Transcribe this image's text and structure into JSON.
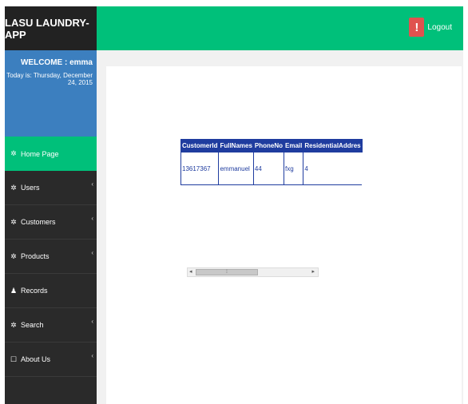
{
  "app": {
    "title": "LASU LAUNDRY-APP"
  },
  "header": {
    "logout_label": "Logout",
    "logout_icon": "alert-icon"
  },
  "welcome": {
    "greeting": "WELCOME : emma",
    "date": "Today is: Thursday, December 24, 2015"
  },
  "sidebar": {
    "items": [
      {
        "label": "Home Page",
        "icon": "✲",
        "active": true
      },
      {
        "label": "Users",
        "icon": "✲"
      },
      {
        "label": "Customers",
        "icon": "✲"
      },
      {
        "label": "Products",
        "icon": "✲"
      },
      {
        "label": "Records",
        "icon": "♟"
      },
      {
        "label": "Search",
        "icon": "✲"
      },
      {
        "label": "About Us",
        "icon": "☐"
      }
    ]
  },
  "table": {
    "columns": [
      "CustomerId",
      "FullNames",
      "PhoneNo",
      "Email",
      "ResidentialAddres"
    ],
    "rows": [
      [
        "13617367",
        "emmanuel",
        "44",
        "fxg",
        "4"
      ]
    ]
  },
  "colors": {
    "accent": "#00c07a",
    "brand_bg": "#222222",
    "welcome_bg": "#3c7fbf",
    "table_header": "#1f3c9f",
    "logout": "#e0524f"
  }
}
